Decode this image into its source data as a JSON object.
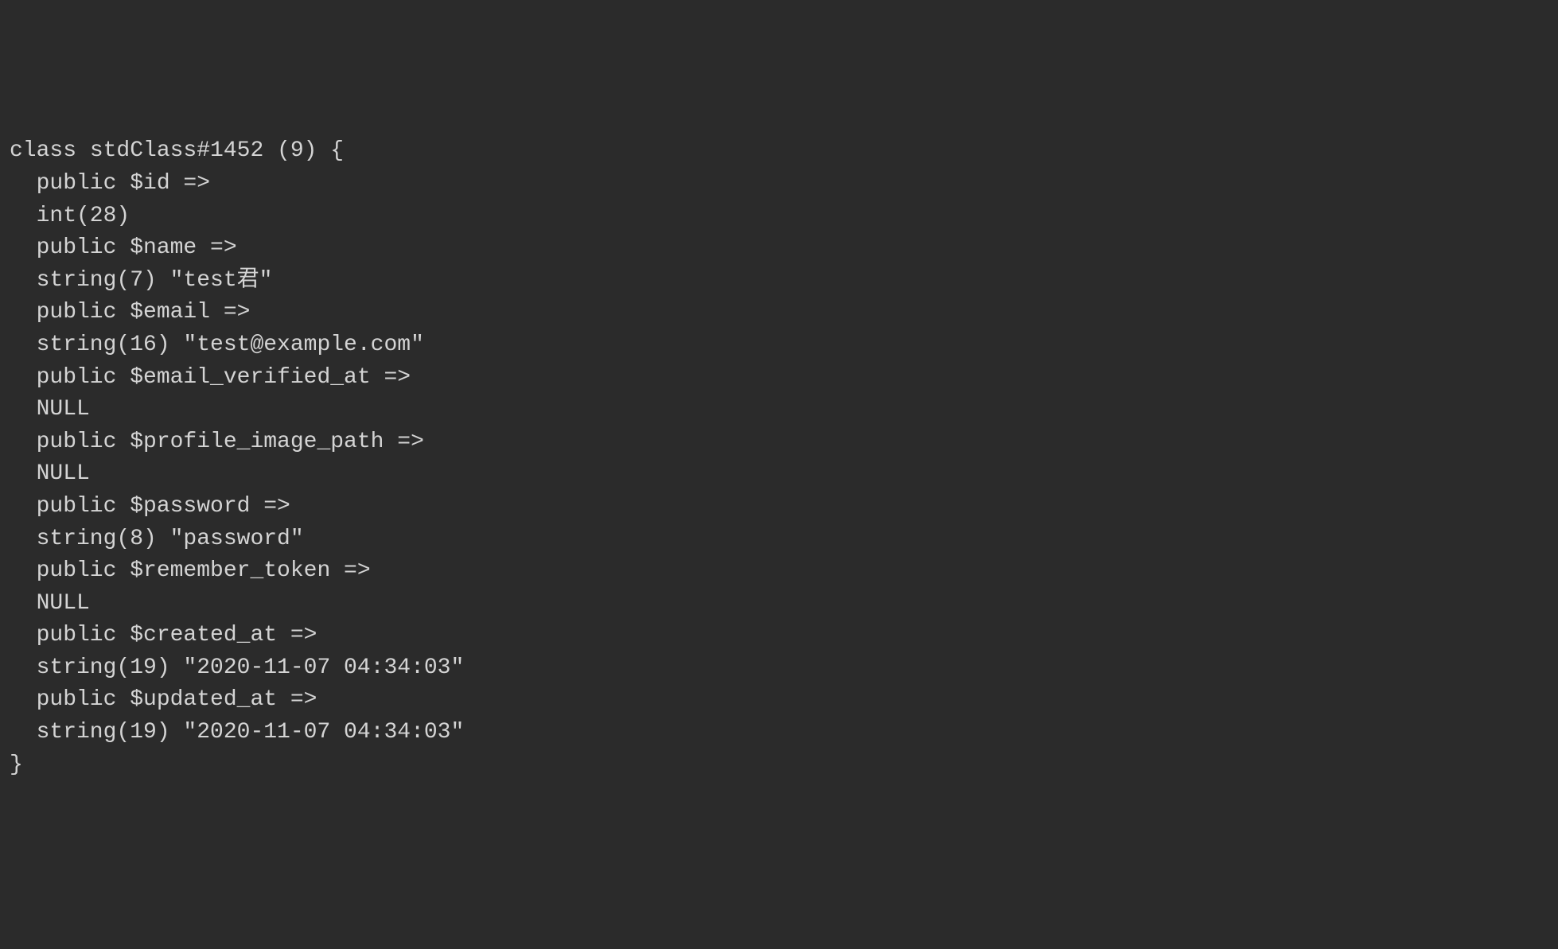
{
  "dump": {
    "header": "class stdClass#1452 (9) {",
    "properties": [
      {
        "decl": "public $id =>",
        "value": "int(28)"
      },
      {
        "decl": "public $name =>",
        "value": "string(7) \"test君\""
      },
      {
        "decl": "public $email =>",
        "value": "string(16) \"test@example.com\""
      },
      {
        "decl": "public $email_verified_at =>",
        "value": "NULL"
      },
      {
        "decl": "public $profile_image_path =>",
        "value": "NULL"
      },
      {
        "decl": "public $password =>",
        "value": "string(8) \"password\""
      },
      {
        "decl": "public $remember_token =>",
        "value": "NULL"
      },
      {
        "decl": "public $created_at =>",
        "value": "string(19) \"2020-11-07 04:34:03\""
      },
      {
        "decl": "public $updated_at =>",
        "value": "string(19) \"2020-11-07 04:34:03\""
      }
    ],
    "footer": "}"
  }
}
